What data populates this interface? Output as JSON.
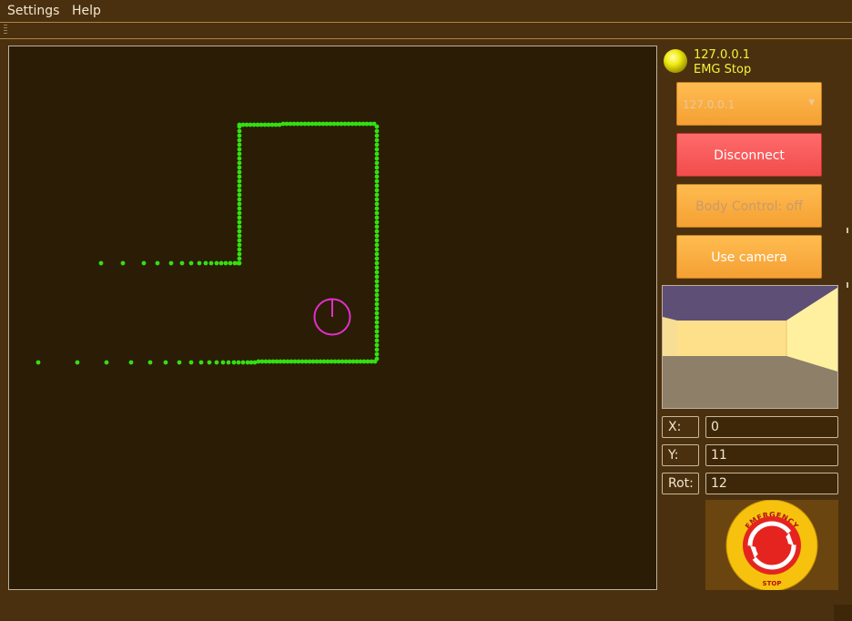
{
  "menu": {
    "settings": "Settings",
    "help": "Help"
  },
  "map": {
    "wall_color": "#33e013",
    "robot_color": "#e030c8"
  },
  "status": {
    "address": "127.0.0.1",
    "state": "EMG Stop",
    "led_color": "#f0ea10"
  },
  "controls": {
    "host_select": "127.0.0.1",
    "disconnect": "Disconnect",
    "body_control": "Body Control: off",
    "use_camera": "Use camera"
  },
  "pose": {
    "x_label": "X:",
    "x_value": "0",
    "y_label": "Y:",
    "y_value": "11",
    "rot_label": "Rot:",
    "rot_value": "12"
  },
  "estop": {
    "top_text": "EMERGENCY",
    "bottom_text": "STOP",
    "icon": "emergency-stop-icon"
  },
  "colors": {
    "background": "#4a300e",
    "map_background": "#2b1c05",
    "button": "#f5a033",
    "button_danger": "#f24c4c"
  }
}
